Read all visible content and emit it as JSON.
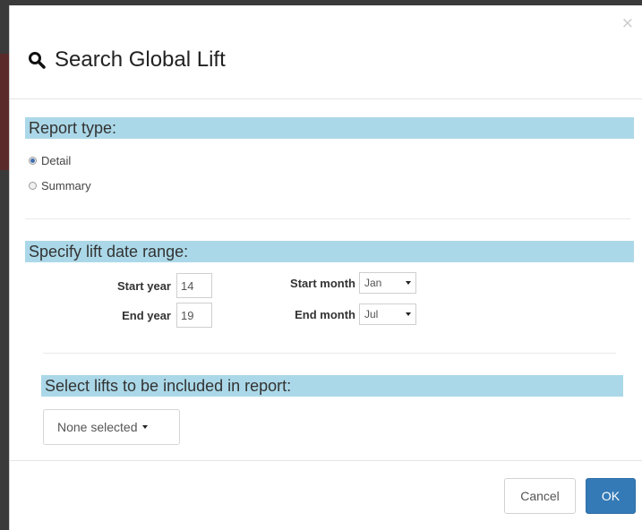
{
  "modal": {
    "title": "Search Global Lift",
    "close_label": "×"
  },
  "report_type": {
    "heading": "Report type:",
    "options": [
      {
        "label": "Detail",
        "checked": true
      },
      {
        "label": "Summary",
        "checked": false
      }
    ]
  },
  "date_range": {
    "heading": "Specify lift date range:",
    "start_year_label": "Start year",
    "start_year_value": "14",
    "end_year_label": "End year",
    "end_year_value": "19",
    "start_month_label": "Start month",
    "start_month_value": "Jan",
    "end_month_label": "End month",
    "end_month_value": "Jul"
  },
  "lifts": {
    "heading": "Select lifts to be included in report:",
    "button_label": "None selected"
  },
  "footer": {
    "cancel_label": "Cancel",
    "ok_label": "OK"
  },
  "colors": {
    "section_bar": "#abd8e8",
    "ok_button": "#337ab7"
  },
  "icons": {
    "title": "search-icon",
    "close": "close-icon",
    "dropdown": "caret-down-icon"
  }
}
